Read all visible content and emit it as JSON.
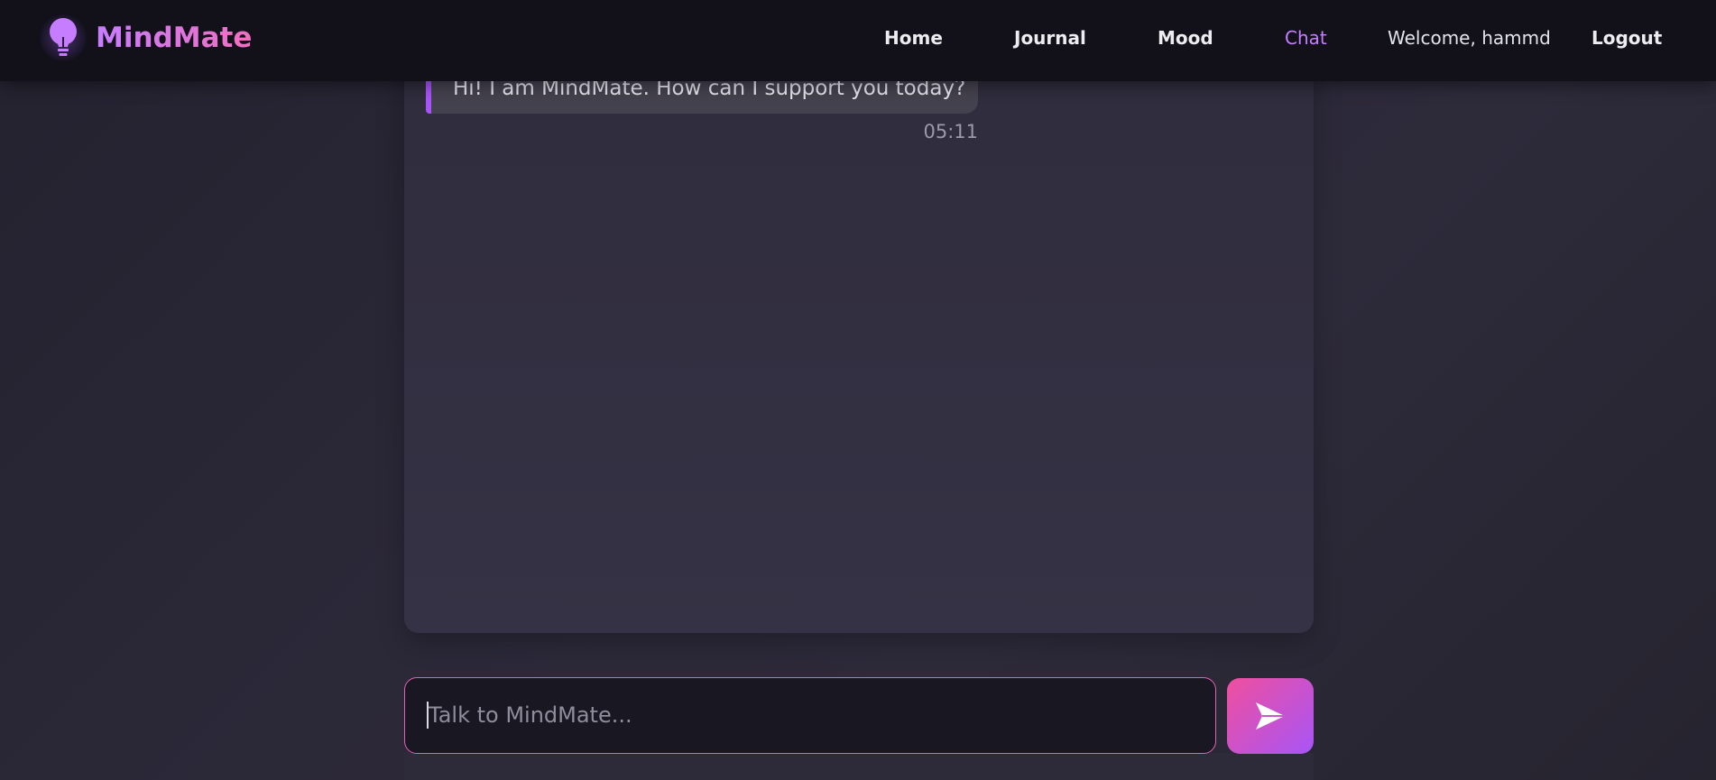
{
  "brand": {
    "name": "MindMate",
    "logo_icon": "lightbulb-icon"
  },
  "nav": {
    "items": [
      {
        "label": "Home",
        "active": false
      },
      {
        "label": "Journal",
        "active": false
      },
      {
        "label": "Mood",
        "active": false
      },
      {
        "label": "Chat",
        "active": true
      }
    ],
    "welcome": "Welcome, hammd",
    "logout": "Logout"
  },
  "chat": {
    "messages": [
      {
        "sender": "bot",
        "text": "Hi! I am MindMate. How can I support you today?",
        "time": "05:11"
      }
    ]
  },
  "composer": {
    "placeholder": "Talk to MindMate...",
    "send_icon": "send-icon"
  },
  "colors": {
    "accent_purple": "#a855f7",
    "accent_pink": "#ef4f9e",
    "nav_active": "#c77dff"
  }
}
